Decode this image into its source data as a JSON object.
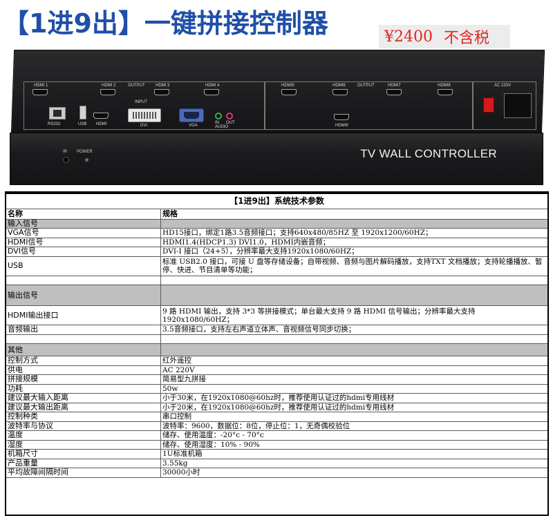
{
  "header": {
    "title": "【1进9出】一键拼接控制器",
    "price": "¥2400",
    "tax_note": "不含税"
  },
  "device": {
    "rear_labels": {
      "hdmi1": "HDMI 1",
      "hdmi2": "HDMI 2",
      "output1": "OUTPUT",
      "hdmi3": "HDMI 3",
      "hdmi4": "HDMI 4",
      "hdmi5": "HDMI5",
      "hdmi6": "HDMI6",
      "output2": "OUTPUT",
      "hdmi7": "HDMI7",
      "hdmi8": "HDMI8",
      "hdmi9": "HDMI9",
      "input": "INPUT",
      "rs232": "RS232",
      "usb": "USB",
      "hdmi_in": "HDMI",
      "dvi": "DVI",
      "vga": "VGA",
      "audio": "AUDIO",
      "in": "IN",
      "out": "OUT",
      "ac": "AC 220V"
    },
    "front_title": "TV WALL CONTROLLER",
    "ir_label": "IR",
    "power_label": "POWER"
  },
  "spec_table": {
    "title": "【1进9出】系统技术参数",
    "col_name": "名称",
    "col_spec": "规格",
    "sections": [
      {
        "name": "输入信号",
        "rows": [
          {
            "name": "VGA信号",
            "spec": "HD15接口，绑定1路3.5音频接口；支持640x480/85HZ 至 1920x1200/60HZ；"
          },
          {
            "name": "HDMI信号",
            "spec": "HDMI1.4(HDCP1.3) DVI1.0，HDMI内嵌音频；"
          },
          {
            "name": "DVI信号",
            "spec": "DVI-I 接口（24+5），分辨率最大支持1920x1080/60HZ；"
          },
          {
            "name": "USB",
            "spec": "标准 USB2.0 接口，可接 U 盘等存储设备；自带视频、音频与图片解码播放，支持TXT 文档播放；支持轮播播放、暂停、快进、节目清单等功能；"
          },
          {
            "name": "",
            "spec": ""
          }
        ]
      },
      {
        "name": "输出信号",
        "rows": [
          {
            "name": "HDMI输出接口",
            "spec": "9 路 HDMI 输出，支持 3*3 等拼接模式；单台最大支持 9 路 HDMI 信号输出；分辨率最大支持 1920x1080/60HZ；"
          },
          {
            "name": "音频输出",
            "spec": "3.5音频接口，支持左右声道立体声、音视频信号同步切换；"
          },
          {
            "name": "",
            "spec": ""
          }
        ]
      },
      {
        "name": "其他",
        "rows": [
          {
            "name": "控制方式",
            "spec": "红外遥控"
          },
          {
            "name": "供电",
            "spec": "AC 220V"
          },
          {
            "name": "拼接规模",
            "spec": "简易型九拼接"
          },
          {
            "name": "功耗",
            "spec": "50w"
          },
          {
            "name": "建议最大输入距离",
            "spec": "小于30米，在1920x1080@60hz时，推荐使用认证过的hdmi专用线材"
          },
          {
            "name": "建议最大输出距离",
            "spec": "小于20米，在1920x1080@60hz时，推荐使用认证过的hdmi专用线材"
          },
          {
            "name": "控制种类",
            "spec": "串口控制"
          },
          {
            "name": "波特率与协议",
            "spec": "波特率：9600，数据位：8位，停止位：1，无奇偶校验位"
          },
          {
            "name": "温度",
            "spec": "储存、使用温度：-20°c - 70°c"
          },
          {
            "name": "湿度",
            "spec": "储存、使用湿度：10% - 90%"
          },
          {
            "name": "机箱尺寸",
            "spec": "1U标准机箱"
          },
          {
            "name": "产品重量",
            "spec": "3.55kg"
          },
          {
            "name": "平均故障间隔时间",
            "spec": "30000小时"
          }
        ]
      }
    ]
  }
}
